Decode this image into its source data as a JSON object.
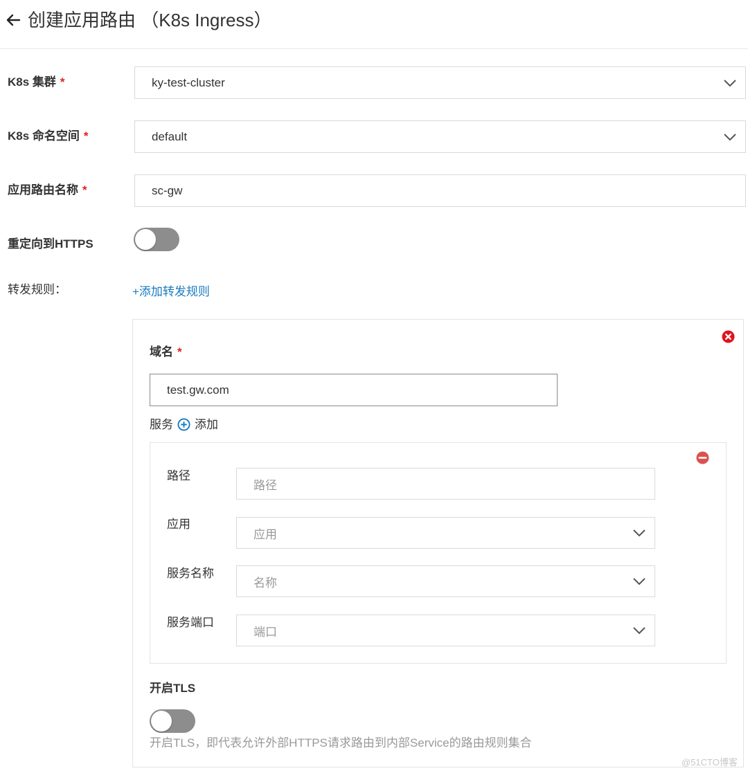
{
  "header": {
    "title": "创建应用路由 （K8s Ingress）"
  },
  "form": {
    "required_mark": "*",
    "cluster": {
      "label": "K8s 集群",
      "value": "ky-test-cluster"
    },
    "namespace": {
      "label": "K8s 命名空间",
      "value": "default"
    },
    "route_name": {
      "label": "应用路由名称",
      "value": "sc-gw"
    },
    "https_redirect": {
      "label": "重定向到HTTPS",
      "enabled": false
    },
    "rules_label": "转发规则：",
    "add_rule_link": "+添加转发规则"
  },
  "rule": {
    "domain_label": "域名",
    "domain_value": "test.gw.com",
    "service_label": "服务",
    "add_service_label": "添加",
    "service": {
      "path_label": "路径",
      "path_placeholder": "路径",
      "app_label": "应用",
      "app_placeholder": "应用",
      "service_name_label": "服务名称",
      "service_name_placeholder": "名称",
      "service_port_label": "服务端口",
      "service_port_placeholder": "端口"
    },
    "tls_label": "开启TLS",
    "tls_enabled": false,
    "tls_help": "开启TLS，即代表允许外部HTTPS请求路由到内部Service的路由规则集合"
  },
  "watermark": "@51CTO博客",
  "colors": {
    "required": "#e02020",
    "link": "#1a7bc1",
    "toggle_off": "#8d8d8d",
    "remove_rule": "#e0141e",
    "remove_service": "#d9534f"
  }
}
